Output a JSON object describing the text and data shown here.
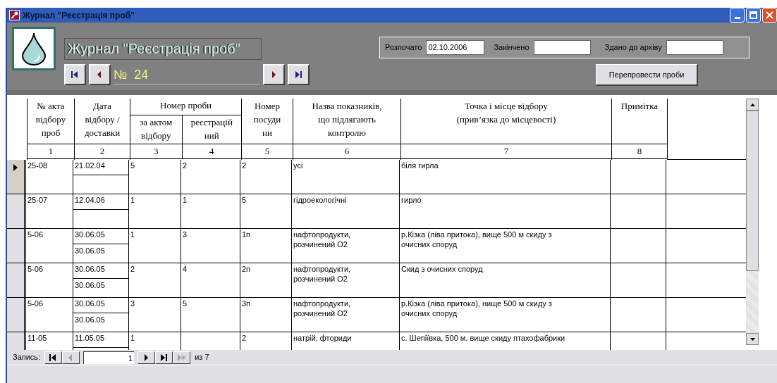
{
  "window": {
    "title": "Журнал \"Реєстрація проб\""
  },
  "header": {
    "title": "Журнал \"Реєстрація проб\"",
    "record_number": "№  24",
    "nav": [
      {
        "kind": "first"
      },
      {
        "kind": "prev"
      },
      {
        "kind": "next"
      },
      {
        "kind": "last"
      }
    ],
    "fields": [
      {
        "label": "Розпочато",
        "value": "02.10.2006"
      },
      {
        "label": "Закінчено"
      },
      {
        "label": "Здано до архіву"
      }
    ],
    "button": "Перепровести проби"
  },
  "table": {
    "columns": [
      {
        "label": "№ акта\nвідбору\nпроб",
        "number": "1"
      },
      {
        "label": "Дата\nвідбору /\nдоставки",
        "number": "2"
      },
      {
        "label": "Номер проби",
        "children": [
          {
            "label": "за актом\nвідбору",
            "number": "3"
          },
          {
            "label": "реєстрацій\nний",
            "number": "4"
          }
        ]
      },
      {
        "label": "Номер\nпосуди\nни",
        "number": "5"
      },
      {
        "label": "Назва показників,\nщо підлягають\nконтролю",
        "number": "6"
      },
      {
        "label": "Точка і місце  відбору\n(прив’язка до місцевості)",
        "number": "7"
      },
      {
        "label": "Примітка",
        "number": "8"
      }
    ],
    "rows": [
      {
        "selected": true,
        "act": "25-08",
        "sampled": "21.02.04",
        "by_act": "5",
        "registration": "2",
        "vessel": "2",
        "indicators": "усі",
        "location": "біля гирла"
      },
      {
        "selected": false,
        "act": "25-07",
        "sampled": "12.04.06",
        "by_act": "1",
        "registration": "1",
        "vessel": "5",
        "indicators": "гідроекологічні",
        "location": "гирло"
      },
      {
        "selected": false,
        "act": "5-06",
        "sampled": "30.06.05",
        "delivered": "30.06.05",
        "by_act": "1",
        "registration": "3",
        "vessel": "1п",
        "indicators": "нафтопродукти, розчинений О2",
        "location": "р.Кізка (ліва притока), вище 500 м скиду з очисних споруд"
      },
      {
        "selected": false,
        "act": "5-06",
        "sampled": "30.06.05",
        "delivered": "30.06.05",
        "by_act": "2",
        "registration": "4",
        "vessel": "2п",
        "indicators": "нафтопродукти, розчинений О2",
        "location": "Скид з очисних споруд"
      },
      {
        "selected": false,
        "act": "5-06",
        "sampled": "30.06.05",
        "delivered": "30.06.05",
        "by_act": "3",
        "registration": "5",
        "vessel": "3п",
        "indicators": "нафтопродукти, розчинений О2",
        "location": "р.Кізка (ліва притока), нище 500 м скиду з очисних споруд"
      },
      {
        "selected": false,
        "act": "11-05",
        "sampled": "11.05.05",
        "by_act": "1",
        "vessel": "2",
        "indicators": "натрій, фториди",
        "location": "с. Шепіївка, 500 м. вище скиду птахофабрики"
      }
    ]
  },
  "record_nav": {
    "label": "Запись:",
    "current": "1",
    "total": "из 7",
    "buttons": [
      {
        "kind": "first",
        "disabled": false
      },
      {
        "kind": "prev",
        "disabled": true
      },
      {
        "kind": "next",
        "disabled": false
      },
      {
        "kind": "last",
        "disabled": false
      },
      {
        "kind": "new",
        "disabled": true
      }
    ]
  }
}
